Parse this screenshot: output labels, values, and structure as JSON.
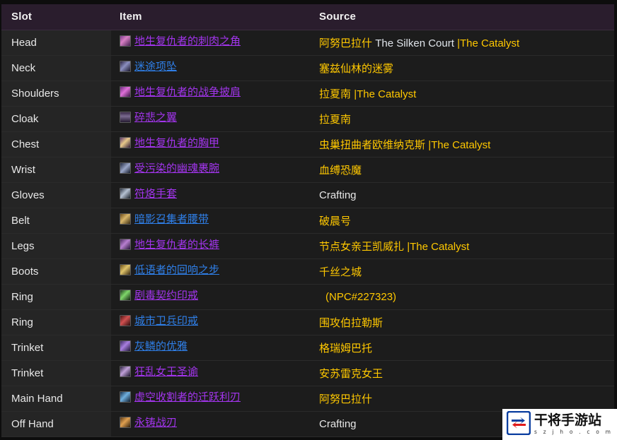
{
  "table": {
    "columns": [
      {
        "key": "slot",
        "label": "Slot"
      },
      {
        "key": "item",
        "label": "Item"
      },
      {
        "key": "source",
        "label": "Source"
      }
    ],
    "rows": [
      {
        "slot": "Head",
        "item": {
          "name": "地生复仇者的刺肉之角",
          "quality": "epic",
          "icon": "helm-icon"
        },
        "source": {
          "boss": "阿努巴拉什",
          "zone": "The Silken Court",
          "separator": "|",
          "catalyst": "The Catalyst"
        }
      },
      {
        "slot": "Neck",
        "item": {
          "name": "迷途项坠",
          "quality": "rare",
          "icon": "necklace-icon"
        },
        "source": {
          "boss": "塞兹仙林的迷雾",
          "zone": "",
          "separator": "",
          "catalyst": ""
        }
      },
      {
        "slot": "Shoulders",
        "item": {
          "name": "地生复仇者的战争披肩",
          "quality": "epic",
          "icon": "shoulder-icon"
        },
        "source": {
          "boss": "拉夏南",
          "zone": "",
          "separator": "|",
          "catalyst": "The Catalyst"
        }
      },
      {
        "slot": "Cloak",
        "item": {
          "name": "碎悲之翼",
          "quality": "epic",
          "icon": "cloak-icon"
        },
        "source": {
          "boss": "拉夏南",
          "zone": "",
          "separator": "",
          "catalyst": ""
        }
      },
      {
        "slot": "Chest",
        "item": {
          "name": "地生复仇者的胸甲",
          "quality": "epic",
          "icon": "chest-icon"
        },
        "source": {
          "boss": "虫巢扭曲者欧维纳克斯",
          "zone": "",
          "separator": "|",
          "catalyst": "The Catalyst"
        }
      },
      {
        "slot": "Wrist",
        "item": {
          "name": "受污染的幽魂裹腕",
          "quality": "epic",
          "icon": "bracer-icon"
        },
        "source": {
          "boss": "血缚恐魔",
          "zone": "",
          "separator": "",
          "catalyst": ""
        }
      },
      {
        "slot": "Gloves",
        "item": {
          "name": "符烙手套",
          "quality": "epic",
          "icon": "gloves-icon"
        },
        "source": {
          "plain": "Crafting"
        }
      },
      {
        "slot": "Belt",
        "item": {
          "name": "暗影召集者腰带",
          "quality": "rare",
          "icon": "belt-icon"
        },
        "source": {
          "boss": "破晨号",
          "zone": "",
          "separator": "",
          "catalyst": ""
        }
      },
      {
        "slot": "Legs",
        "item": {
          "name": "地生复仇者的长裤",
          "quality": "epic",
          "icon": "legs-icon"
        },
        "source": {
          "boss": "节点女亲王凯威扎",
          "zone": "",
          "separator": "|",
          "catalyst": "The Catalyst"
        }
      },
      {
        "slot": "Boots",
        "item": {
          "name": "低语者的回响之步",
          "quality": "rare",
          "icon": "boots-icon"
        },
        "source": {
          "boss": "千丝之城",
          "zone": "",
          "separator": "",
          "catalyst": ""
        }
      },
      {
        "slot": "Ring",
        "item": {
          "name": "剧毒契约印戒",
          "quality": "epic",
          "icon": "ring-icon"
        },
        "source": {
          "boss": " (NPC#227323)",
          "zone": "",
          "separator": "",
          "catalyst": "",
          "indent": true
        }
      },
      {
        "slot": "Ring",
        "item": {
          "name": "城市卫兵印戒",
          "quality": "rare",
          "icon": "ring-icon"
        },
        "source": {
          "boss": "围攻伯拉勒斯",
          "zone": "",
          "separator": "",
          "catalyst": ""
        }
      },
      {
        "slot": "Trinket",
        "item": {
          "name": "灰鳞的优雅",
          "quality": "rare",
          "icon": "trinket-icon"
        },
        "source": {
          "boss": "格瑞姆巴托",
          "zone": "",
          "separator": "",
          "catalyst": ""
        }
      },
      {
        "slot": "Trinket",
        "item": {
          "name": "狂乱女王圣谕",
          "quality": "epic",
          "icon": "trinket-icon"
        },
        "source": {
          "boss": "安苏雷克女王",
          "zone": "",
          "separator": "",
          "catalyst": ""
        }
      },
      {
        "slot": "Main Hand",
        "item": {
          "name": "虚空收割者的迁跃利刃",
          "quality": "epic",
          "icon": "weapon-icon"
        },
        "source": {
          "boss": "阿努巴拉什",
          "zone": "",
          "separator": "",
          "catalyst": ""
        }
      },
      {
        "slot": "Off Hand",
        "item": {
          "name": "永铸战刃",
          "quality": "epic",
          "icon": "offhand-icon"
        },
        "source": {
          "plain": "Crafting"
        }
      }
    ]
  },
  "watermark": {
    "title": "干将手游站",
    "url": "s z j h o . c o m",
    "logo": "recycle-arrows-icon"
  },
  "colors": {
    "epic": "#a335ee",
    "rare": "#2f7fe8",
    "source_boss": "#ffc800",
    "source_zone": "#dfe4ea",
    "header_bg": "#2a1d2d",
    "row_bg": "#1c1c1c",
    "slot_bg": "#252525",
    "page_bg": "#0d0d0d"
  }
}
